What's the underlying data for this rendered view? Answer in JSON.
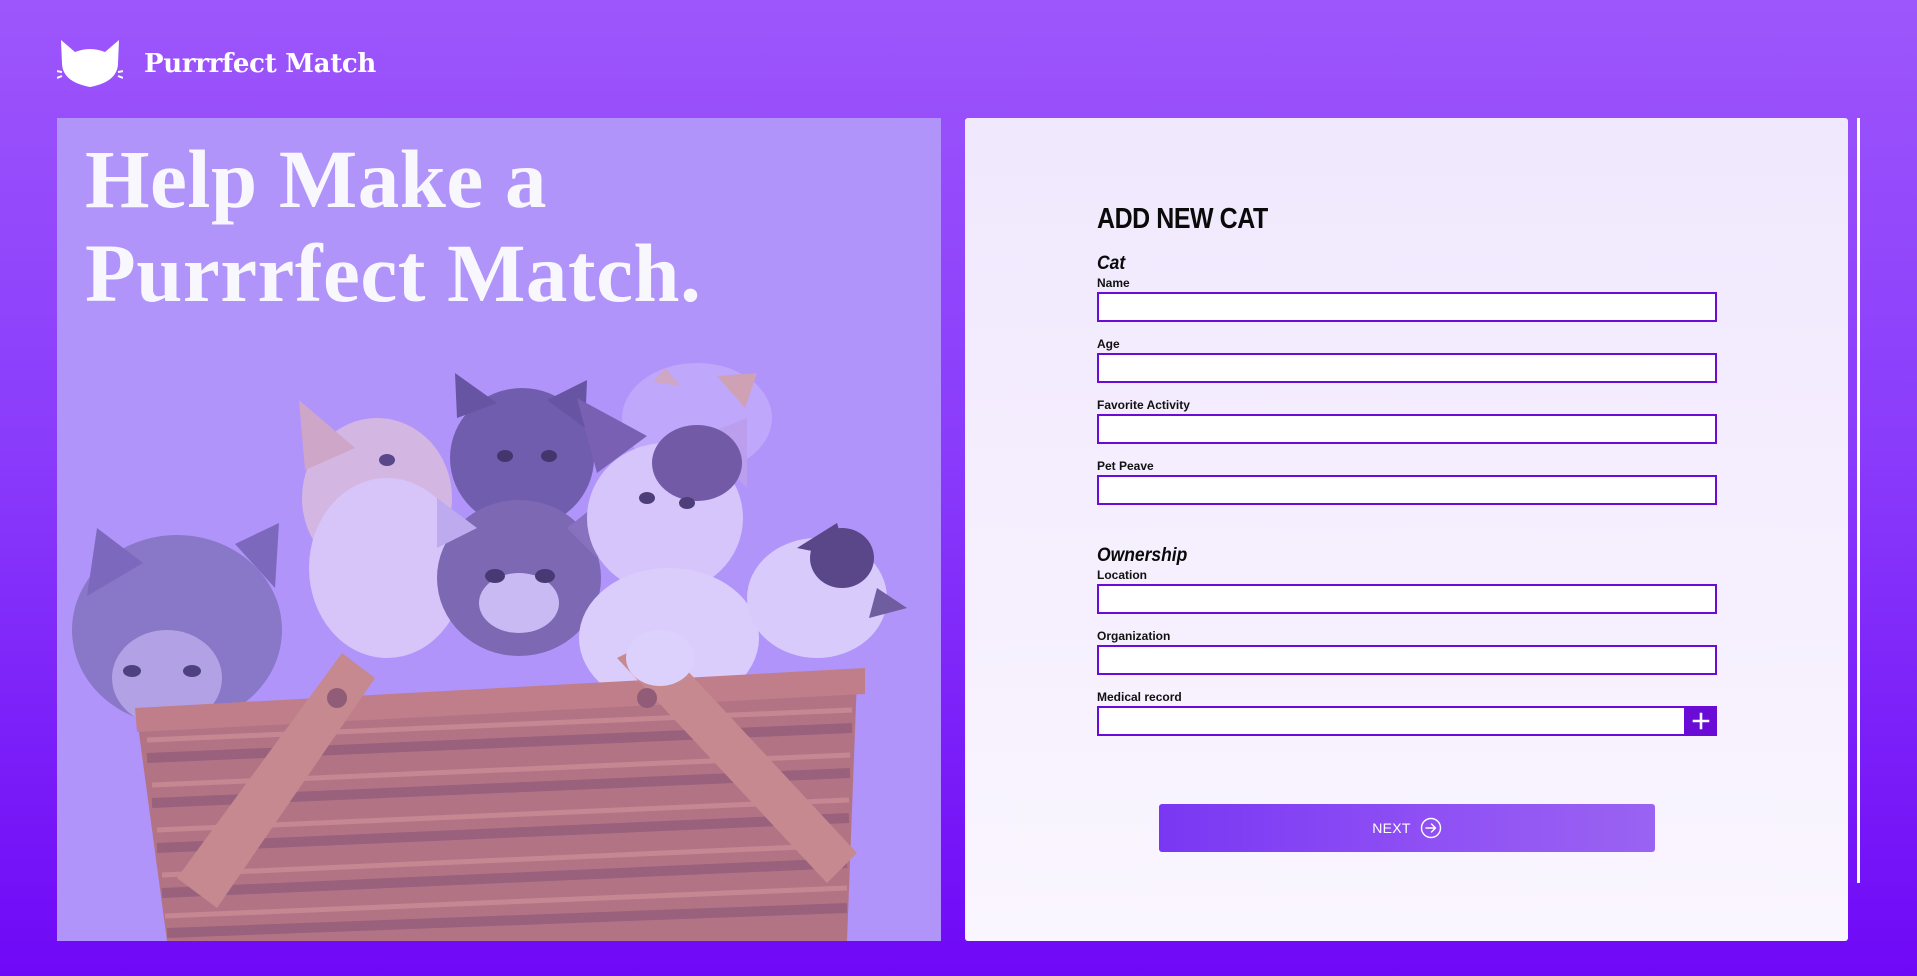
{
  "app": {
    "brand": "Purrrfect Match",
    "logo_icon": "cat-head-icon"
  },
  "hero": {
    "title": "Help Make a Purrrfect Match.",
    "image": "kittens-in-basket-photo",
    "overlay_color": "#a78bfa"
  },
  "form": {
    "title": "ADD NEW CAT",
    "sections": {
      "cat": {
        "title": "Cat",
        "fields": [
          {
            "label": "Name",
            "value": ""
          },
          {
            "label": "Age",
            "value": ""
          },
          {
            "label": "Favorite Activity",
            "value": ""
          },
          {
            "label": "Pet Peave",
            "value": ""
          }
        ]
      },
      "ownership": {
        "title": "Ownership",
        "fields": [
          {
            "label": "Location",
            "value": ""
          },
          {
            "label": "Organization",
            "value": ""
          },
          {
            "label": "Medical record",
            "value": "",
            "action_icon": "plus-icon"
          }
        ]
      }
    },
    "next_button": {
      "label": "NEXT",
      "icon": "arrow-right-circle-icon"
    }
  },
  "colors": {
    "accent": "#6a0cd6",
    "background_top": "#9d56fb",
    "background_bottom": "#6f08f7",
    "panel": "#f3ecfe"
  }
}
